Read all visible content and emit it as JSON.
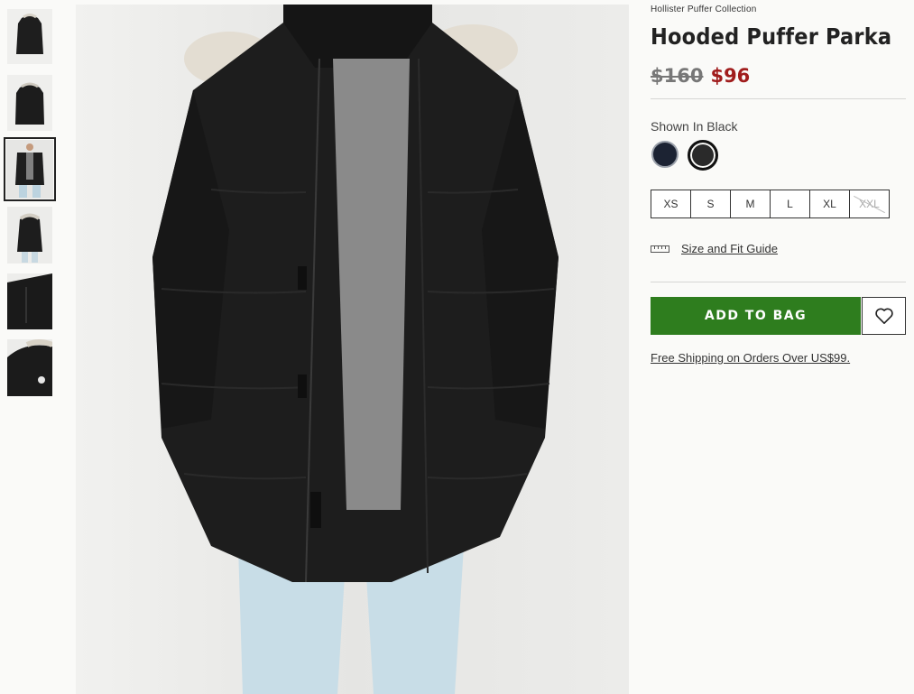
{
  "product": {
    "collection": "Hollister Puffer Collection",
    "title": "Hooded Puffer Parka",
    "price_original": "$160",
    "price_sale": "$96",
    "shown_in": "Shown In Black"
  },
  "gallery": {
    "thumbnail_count": 6,
    "selected_index": 2
  },
  "colors": [
    {
      "name": "Navy",
      "hex": "#1c2333",
      "selected": false
    },
    {
      "name": "Black",
      "hex": "#2a2a2a",
      "selected": true
    }
  ],
  "sizes": [
    {
      "label": "XS",
      "available": true
    },
    {
      "label": "S",
      "available": true
    },
    {
      "label": "M",
      "available": true
    },
    {
      "label": "L",
      "available": true
    },
    {
      "label": "XL",
      "available": true
    },
    {
      "label": "XXL",
      "available": false
    }
  ],
  "actions": {
    "size_guide": "Size and Fit Guide",
    "add_to_bag": "ADD TO BAG",
    "shipping_note": "Free Shipping on Orders Over US$99."
  },
  "icons": {
    "ruler": "ruler-icon",
    "wishlist": "heart-icon"
  },
  "theme": {
    "accent_green": "#2e7d1e",
    "sale_red": "#a01c1c"
  }
}
